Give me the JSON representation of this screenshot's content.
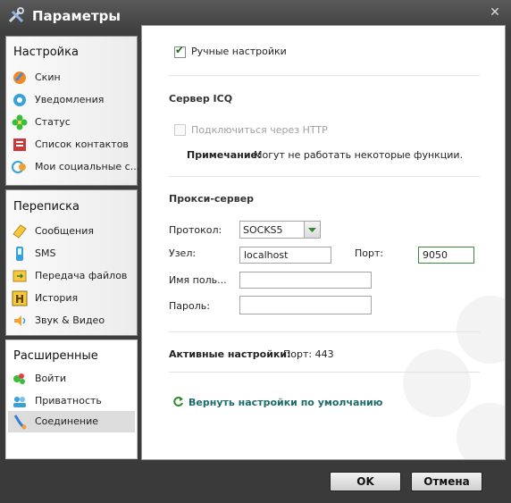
{
  "window": {
    "title": "Параметры"
  },
  "nav": {
    "groups": [
      {
        "title": "Настройка",
        "items": [
          "Скин",
          "Уведомления",
          "Статус",
          "Список контактов",
          "Мои социальные с..."
        ]
      },
      {
        "title": "Переписка",
        "items": [
          "Сообщения",
          "SMS",
          "Передача файлов",
          "История",
          "Звук & Видео"
        ]
      },
      {
        "title": "Расширенные",
        "items": [
          "Войти",
          "Приватность",
          "Соединение"
        ]
      }
    ],
    "active": "Соединение"
  },
  "main": {
    "manual_checkbox": {
      "label": "Ручные настройки",
      "checked": true
    },
    "icq": {
      "title": "Сервер ICQ",
      "http_label": "Подключиться через HTTP",
      "note_label": "Примечание:",
      "note_text": "Могут не работать некоторые функции."
    },
    "proxy": {
      "title": "Прокси-сервер",
      "protocol_label": "Протокол:",
      "protocol_value": "SOCKS5",
      "host_label": "Узел:",
      "host_value": "localhost",
      "port_label": "Порт:",
      "port_value": "9050",
      "user_label": "Имя поль...",
      "user_value": "",
      "password_label": "Пароль:",
      "password_value": ""
    },
    "active": {
      "label": "Активные настройки:",
      "value": "Порт: 443"
    },
    "reset_link": "Вернуть настройки по умолчанию"
  },
  "buttons": {
    "ok": "OK",
    "cancel": "Отмена"
  },
  "colors": {
    "accent": "#2e8b2e",
    "link": "#1d6b6b",
    "frame": "#3a3a3a"
  },
  "icons": {
    "app": "tools-icon",
    "nav": [
      "skin-icon",
      "bell-icon",
      "status-flower-icon",
      "contacts-icon",
      "social-icon",
      "messages-icon",
      "sms-icon",
      "file-transfer-icon",
      "history-icon",
      "sound-video-icon",
      "login-icon",
      "privacy-icon",
      "connection-icon"
    ]
  }
}
